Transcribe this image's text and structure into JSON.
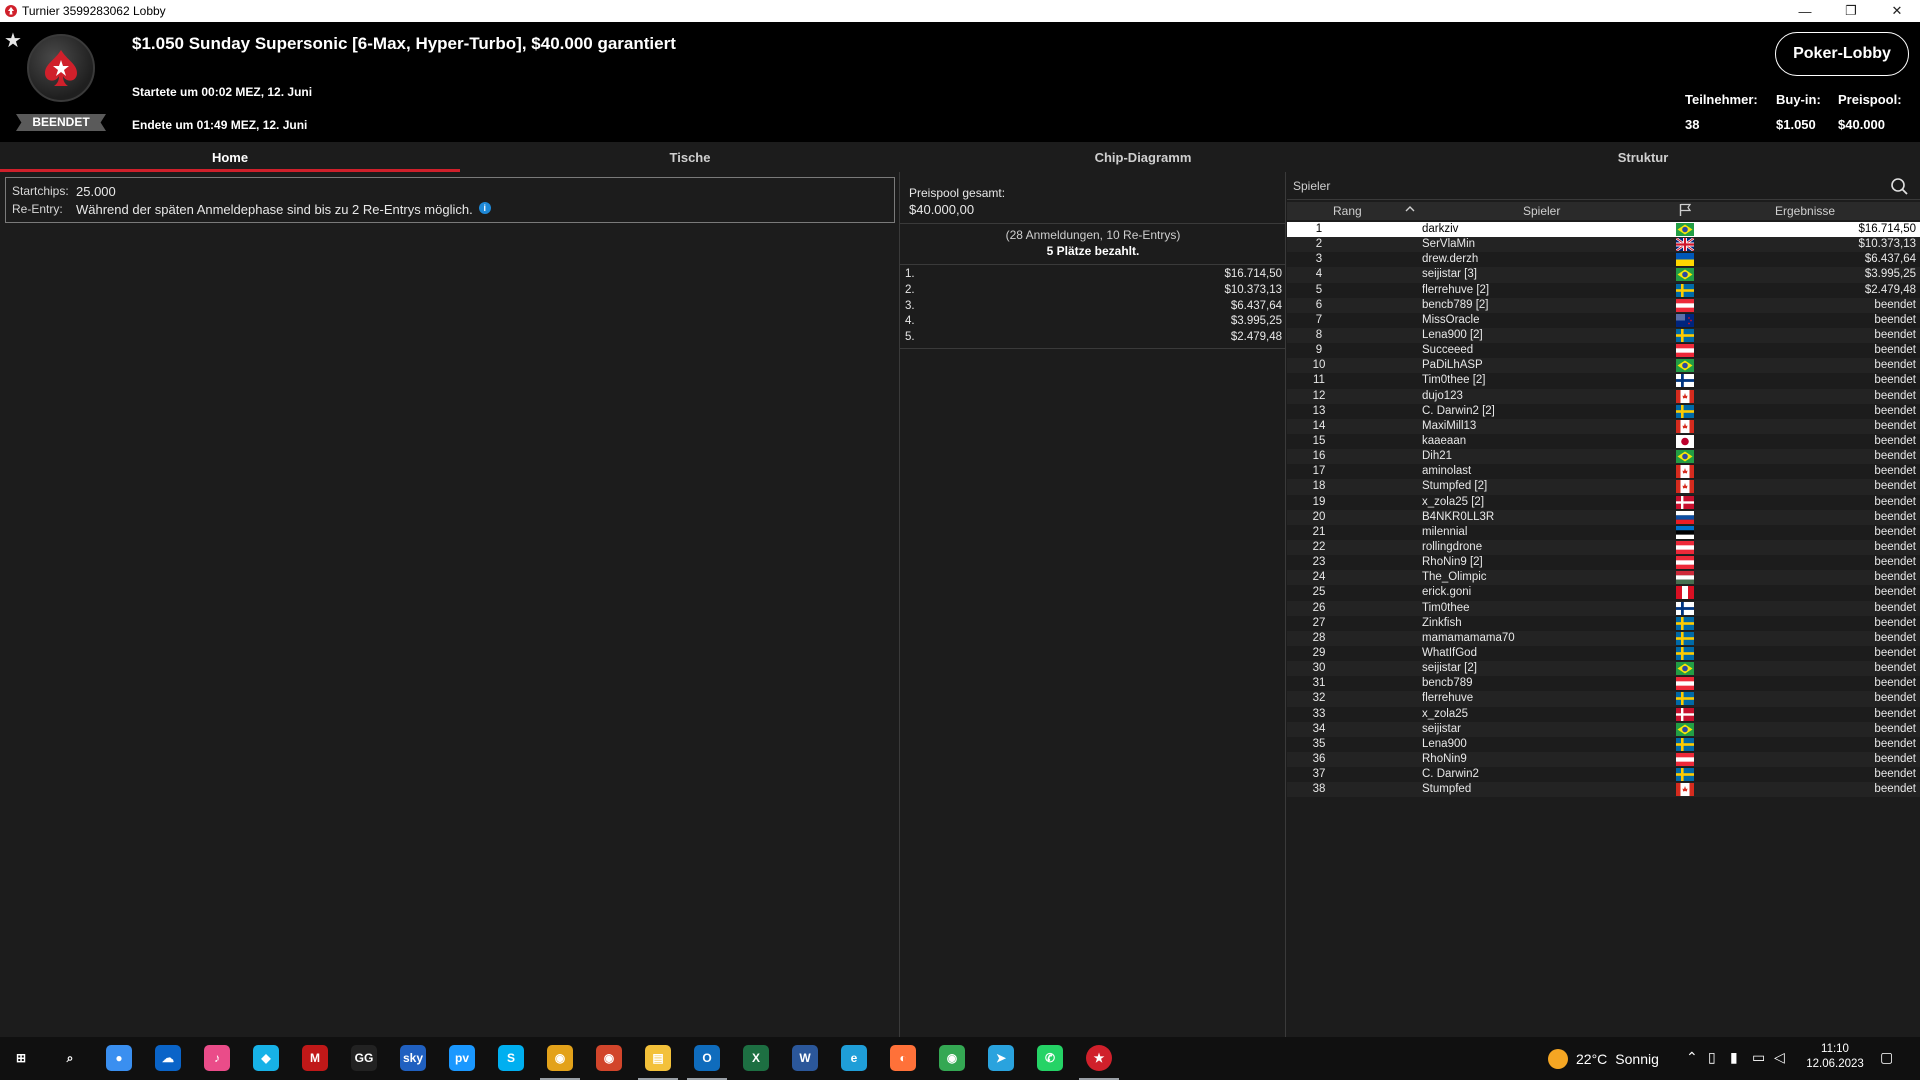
{
  "window": {
    "title": "Turnier 3599283062 Lobby",
    "minimize": "—",
    "maximize": "❐",
    "close": "✕"
  },
  "header": {
    "title": "$1.050 Sunday Supersonic [6-Max, Hyper-Turbo], $40.000 garantiert",
    "started": "Startete um 00:02 MEZ, 12. Juni",
    "ended": "Endete um 01:49 MEZ, 12. Juni",
    "status": "BEENDET",
    "lobby_button": "Poker-Lobby",
    "stats": [
      {
        "label": "Teilnehmer:",
        "value": "38"
      },
      {
        "label": "Buy-in:",
        "value": "$1.050"
      },
      {
        "label": "Preispool:",
        "value": "$40.000"
      }
    ]
  },
  "tabs": [
    {
      "label": "Home",
      "active": true
    },
    {
      "label": "Tische",
      "active": false
    },
    {
      "label": "Chip-Diagramm",
      "active": false
    },
    {
      "label": "Struktur",
      "active": false
    }
  ],
  "home": {
    "startchips_label": "Startchips:",
    "startchips_value": "25.000",
    "reentry_label": "Re-Entry:",
    "reentry_value": "Während der späten Anmeldephase sind bis zu 2 Re-Entrys möglich.",
    "info_glyph": "i"
  },
  "prizes": {
    "pool_label": "Preispool gesamt:",
    "pool_value": "$40.000,00",
    "entries": "(28 Anmeldungen, 10 Re-Entrys)",
    "paid": "5 Plätze bezahlt.",
    "payouts": [
      {
        "place": "1.",
        "amount": "$16.714,50"
      },
      {
        "place": "2.",
        "amount": "$10.373,13"
      },
      {
        "place": "3.",
        "amount": "$6.437,64"
      },
      {
        "place": "4.",
        "amount": "$3.995,25"
      },
      {
        "place": "5.",
        "amount": "$2.479,48"
      }
    ]
  },
  "players": {
    "search_placeholder": "Spieler",
    "headers": {
      "rank": "Rang",
      "player": "Spieler",
      "result": "Ergebnisse"
    },
    "rows": [
      {
        "rank": "1",
        "name": "darkziv",
        "flag": "br",
        "result": "$16.714,50"
      },
      {
        "rank": "2",
        "name": "SerVlaMin",
        "flag": "gb",
        "result": "$10.373,13"
      },
      {
        "rank": "3",
        "name": "drew.derzh",
        "flag": "ua",
        "result": "$6.437,64"
      },
      {
        "rank": "4",
        "name": "seijistar [3]",
        "flag": "br",
        "result": "$3.995,25"
      },
      {
        "rank": "5",
        "name": "flerrehuve [2]",
        "flag": "se",
        "result": "$2.479,48"
      },
      {
        "rank": "6",
        "name": "bencb789 [2]",
        "flag": "at",
        "result": "beendet"
      },
      {
        "rank": "7",
        "name": "MissOracle",
        "flag": "nz",
        "result": "beendet"
      },
      {
        "rank": "8",
        "name": "Lena900 [2]",
        "flag": "se",
        "result": "beendet"
      },
      {
        "rank": "9",
        "name": "Succeeed",
        "flag": "at",
        "result": "beendet"
      },
      {
        "rank": "10",
        "name": "PaDiLhASP",
        "flag": "br",
        "result": "beendet"
      },
      {
        "rank": "11",
        "name": "Tim0thee [2]",
        "flag": "fi",
        "result": "beendet"
      },
      {
        "rank": "12",
        "name": "dujo123",
        "flag": "ca",
        "result": "beendet"
      },
      {
        "rank": "13",
        "name": "C. Darwin2 [2]",
        "flag": "se",
        "result": "beendet"
      },
      {
        "rank": "14",
        "name": "MaxiMill13",
        "flag": "ca",
        "result": "beendet"
      },
      {
        "rank": "15",
        "name": "kaaeaan",
        "flag": "jp",
        "result": "beendet"
      },
      {
        "rank": "16",
        "name": "Dih21",
        "flag": "br",
        "result": "beendet"
      },
      {
        "rank": "17",
        "name": "aminolast",
        "flag": "ca",
        "result": "beendet"
      },
      {
        "rank": "18",
        "name": "Stumpfed [2]",
        "flag": "ca",
        "result": "beendet"
      },
      {
        "rank": "19",
        "name": "x_zola25 [2]",
        "flag": "dk",
        "result": "beendet"
      },
      {
        "rank": "20",
        "name": "B4NKR0LL3R",
        "flag": "sk",
        "result": "beendet"
      },
      {
        "rank": "21",
        "name": "milennial",
        "flag": "ee",
        "result": "beendet"
      },
      {
        "rank": "22",
        "name": "rollingdrone",
        "flag": "at",
        "result": "beendet"
      },
      {
        "rank": "23",
        "name": "RhoNin9 [2]",
        "flag": "at",
        "result": "beendet"
      },
      {
        "rank": "24",
        "name": "The_Olimpic",
        "flag": "hu",
        "result": "beendet"
      },
      {
        "rank": "25",
        "name": "erick.goni",
        "flag": "pe",
        "result": "beendet"
      },
      {
        "rank": "26",
        "name": "Tim0thee",
        "flag": "fi",
        "result": "beendet"
      },
      {
        "rank": "27",
        "name": "Zinkfish",
        "flag": "se",
        "result": "beendet"
      },
      {
        "rank": "28",
        "name": "mamamamama70",
        "flag": "se",
        "result": "beendet"
      },
      {
        "rank": "29",
        "name": "WhatIfGod",
        "flag": "se",
        "result": "beendet"
      },
      {
        "rank": "30",
        "name": "seijistar [2]",
        "flag": "br",
        "result": "beendet"
      },
      {
        "rank": "31",
        "name": "bencb789",
        "flag": "at",
        "result": "beendet"
      },
      {
        "rank": "32",
        "name": "flerrehuve",
        "flag": "se",
        "result": "beendet"
      },
      {
        "rank": "33",
        "name": "x_zola25",
        "flag": "dk",
        "result": "beendet"
      },
      {
        "rank": "34",
        "name": "seijistar",
        "flag": "br",
        "result": "beendet"
      },
      {
        "rank": "35",
        "name": "Lena900",
        "flag": "se",
        "result": "beendet"
      },
      {
        "rank": "36",
        "name": "RhoNin9",
        "flag": "at",
        "result": "beendet"
      },
      {
        "rank": "37",
        "name": "C. Darwin2",
        "flag": "se",
        "result": "beendet"
      },
      {
        "rank": "38",
        "name": "Stumpfed",
        "flag": "ca",
        "result": "beendet"
      }
    ]
  },
  "taskbar": {
    "weather_temp": "22°C",
    "weather_text": "Sonnig",
    "time": "11:10",
    "date": "12.06.2023",
    "apps": [
      "start-icon",
      "search-icon",
      "cortana-icon",
      "onedrive-icon",
      "itunes-icon",
      "kodi-icon",
      "mcafee-icon",
      "gg-poker-icon",
      "sky-go-icon",
      "prime-video-icon",
      "skype-icon",
      "chrome-icon",
      "chrome-profile-icon",
      "file-explorer-icon",
      "outlook-icon",
      "excel-icon",
      "word-icon",
      "edge-icon",
      "firefox-icon",
      "chrome-alt-icon",
      "telegram-icon",
      "whatsapp-icon",
      "pokerstars-icon"
    ]
  },
  "colors": {
    "accent": "#d0202b",
    "background": "#1c1c1c",
    "header_bg": "#000000"
  }
}
